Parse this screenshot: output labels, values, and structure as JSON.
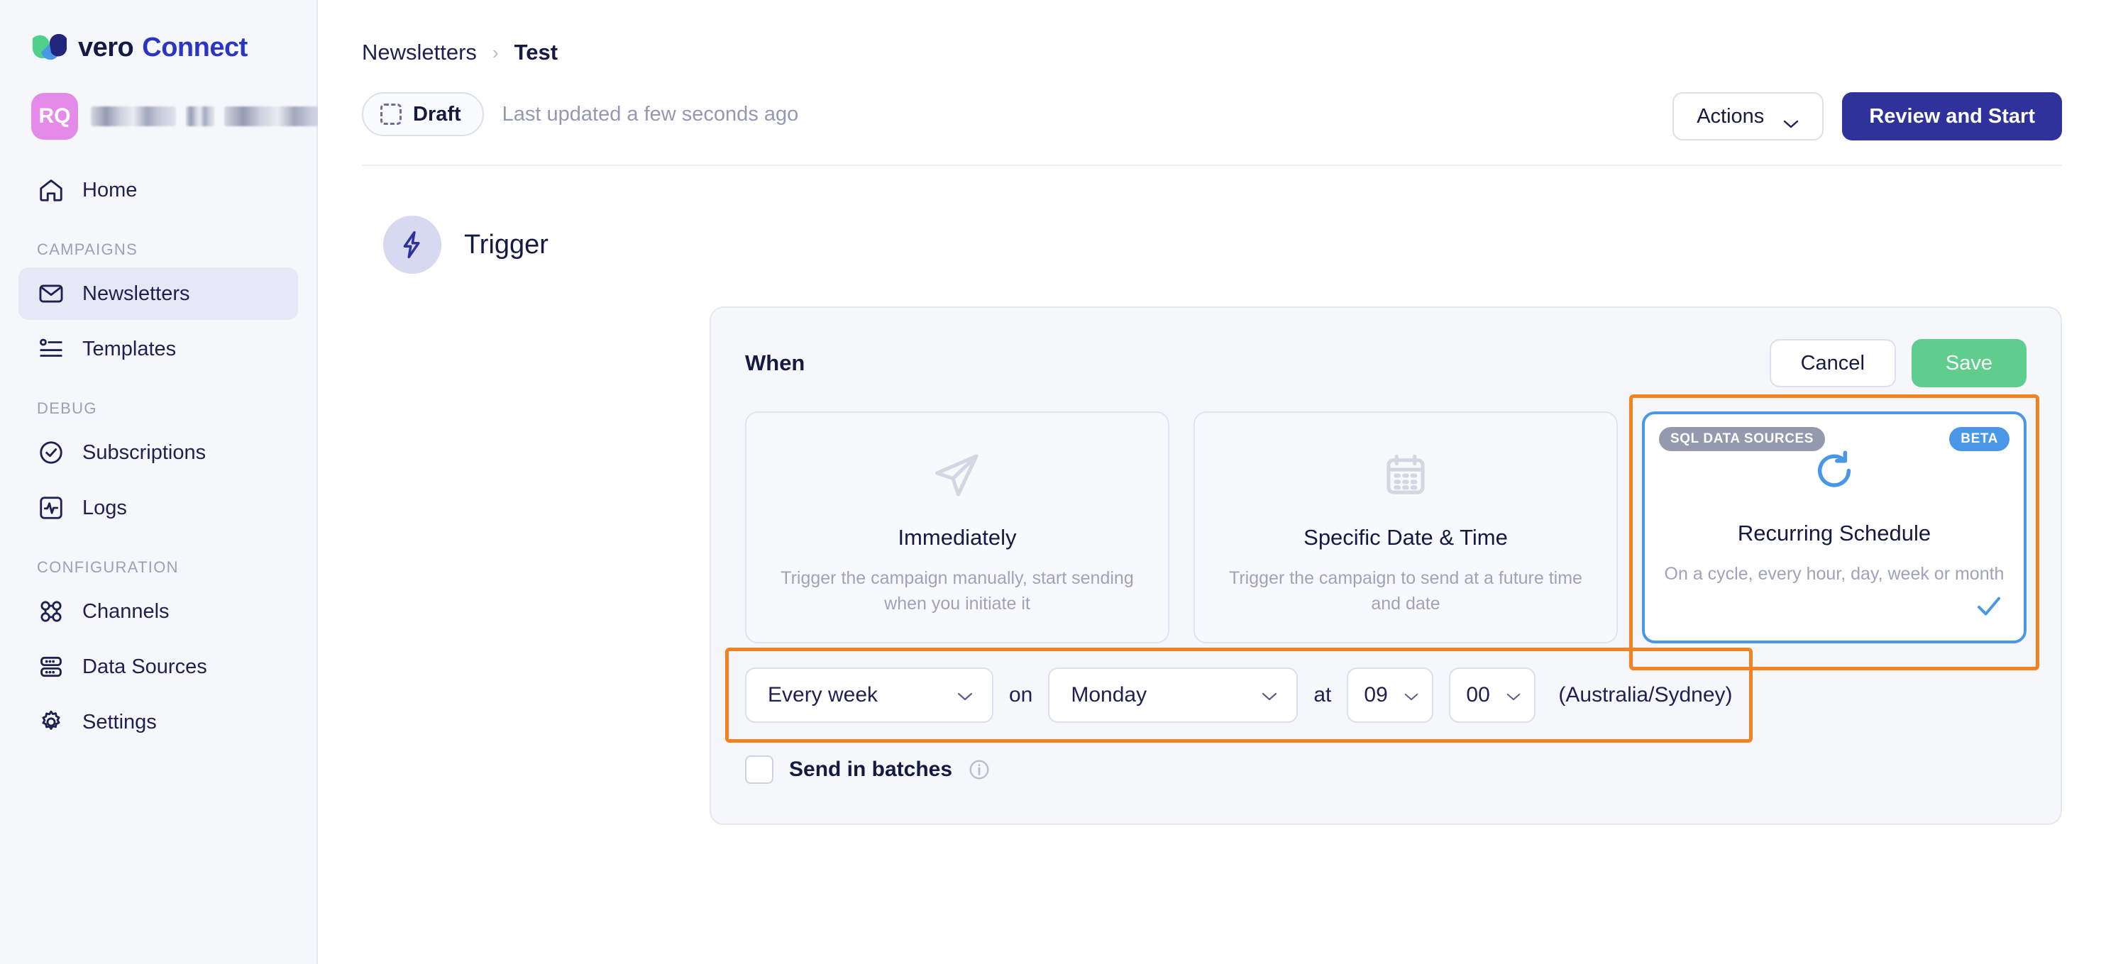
{
  "brand": {
    "name_primary": "vero",
    "name_secondary": "Connect",
    "logo_green": "#4fd18b",
    "logo_blue": "#4a97e8",
    "logo_navy": "#2f329b"
  },
  "user": {
    "initials": "RQ",
    "name_redacted": true
  },
  "sidebar": {
    "top_items": [
      {
        "label": "Home",
        "icon": "home-icon",
        "active": false
      }
    ],
    "sections": [
      {
        "title": "CAMPAIGNS",
        "items": [
          {
            "label": "Newsletters",
            "icon": "envelope-icon",
            "active": true
          },
          {
            "label": "Templates",
            "icon": "list-icon",
            "active": false
          }
        ]
      },
      {
        "title": "DEBUG",
        "items": [
          {
            "label": "Subscriptions",
            "icon": "check-circle-icon",
            "active": false
          },
          {
            "label": "Logs",
            "icon": "activity-icon",
            "active": false
          }
        ]
      },
      {
        "title": "CONFIGURATION",
        "items": [
          {
            "label": "Channels",
            "icon": "channels-icon",
            "active": false
          },
          {
            "label": "Data Sources",
            "icon": "server-icon",
            "active": false
          },
          {
            "label": "Settings",
            "icon": "gear-icon",
            "active": false
          }
        ]
      }
    ]
  },
  "header": {
    "breadcrumb": {
      "parent": "Newsletters",
      "separator": "›",
      "current": "Test"
    },
    "status_badge": "Draft",
    "last_updated": "Last updated a few seconds ago",
    "actions_label": "Actions",
    "primary_label": "Review and Start",
    "primary_color": "#2f329b"
  },
  "trigger": {
    "section_title": "Trigger",
    "when_label": "When",
    "cancel_label": "Cancel",
    "save_label": "Save",
    "save_color": "#5fce8d",
    "options": [
      {
        "title": "Immediately",
        "description": "Trigger the campaign manually, start sending when you initiate it",
        "icon": "paper-plane-icon",
        "selected": false
      },
      {
        "title": "Specific Date & Time",
        "description": "Trigger the campaign to send at a future time and date",
        "icon": "calendar-icon",
        "selected": false
      },
      {
        "title": "Recurring Schedule",
        "description": "On a cycle, every hour, day, week or month",
        "icon": "refresh-cycle-icon",
        "selected": true,
        "badge_left": "SQL DATA SOURCES",
        "badge_right": "BETA"
      }
    ],
    "schedule": {
      "frequency": "Every week",
      "conjunction_on": "on",
      "day": "Monday",
      "conjunction_at": "at",
      "hour": "09",
      "minute": "00",
      "timezone": "(Australia/Sydney)"
    },
    "batches": {
      "label": "Send in batches",
      "checked": false,
      "info_icon": "info-icon"
    },
    "highlight_color": "#f58220"
  }
}
